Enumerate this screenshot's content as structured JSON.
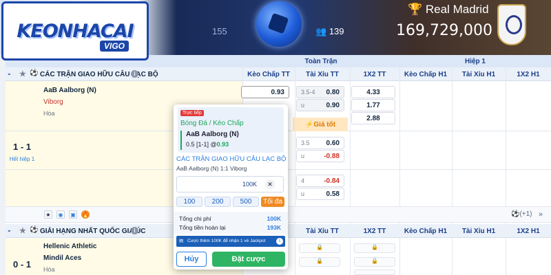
{
  "banner": {
    "logo_main": "KEONHACAI",
    "logo_sub": "VIGO",
    "left_count": "155",
    "users_count": "139",
    "team": "Real Madrid",
    "jackpot": "169,729,000"
  },
  "columns": {
    "group_full": "Toàn Trận",
    "group_h1": "Hiệp 1",
    "keo_chap_tt": "Kèo Chấp TT",
    "tai_xiu_tt": "Tài Xỉu TT",
    "x12_tt": "1X2 TT",
    "keo_chap_h1": "Kèo Chấp H1",
    "tai_xiu_h1": "Tài Xỉu H1",
    "x12_h1": "1X2 H1"
  },
  "league1": {
    "title": "CÁC TRẬN GIAO HỮU CÂU LẠC BỘ",
    "score": "1 - 1",
    "period": "Hết hiệp 1",
    "home": "AaB Aalborg (N)",
    "away": "Viborg",
    "draw": "Hòa",
    "handicap_home": "0.93",
    "ou_line1": "3.5-4",
    "ou_over1": "0.80",
    "ou_u1": "u",
    "ou_under1": "0.90",
    "gia_tot": "Giá tốt",
    "x12_home": "4.33",
    "x12_away": "1.77",
    "x12_draw": "2.88",
    "ou_line2": "3.5",
    "ou_over2": "0.60",
    "ou_u2": "u",
    "ou_under2": "-0.88",
    "ou_line3": "4",
    "ou_over3": "-0.84",
    "ou_u3": "u",
    "ou_under3": "0.58",
    "more_markets": "(+1)"
  },
  "league2": {
    "title": "GIẢI HẠNG NHẤT QUỐC GIA ÚC",
    "score": "0 - 1",
    "home": "Hellenic Athletic",
    "away": "Mindil Aces",
    "draw": "Hòa"
  },
  "bet_slip": {
    "live_badge": "Trực tiếp",
    "sport_market": "Bóng Đá / Kèo Chấp",
    "selection": "AaB Aalborg (N)",
    "line": "0.5 [1-1] @",
    "price": "0.93",
    "league": "CÁC TRẬN GIAO HỮU CÂU LẠC BỘ",
    "match": "AaB Aalborg (N) 1:1 Viborg",
    "stake": "100K",
    "quick1": "100",
    "quick2": "200",
    "quick3": "500",
    "max": "Tối đa",
    "total_cost_label": "Tổng chi phí",
    "total_cost": "100K",
    "refund_label": "Tổng tiền hoàn lại",
    "refund": "193K",
    "promo": "Cược thêm 100K để nhận 1 vé Jackpot",
    "cancel": "Hủy",
    "place_bet": "Đặt cược"
  }
}
